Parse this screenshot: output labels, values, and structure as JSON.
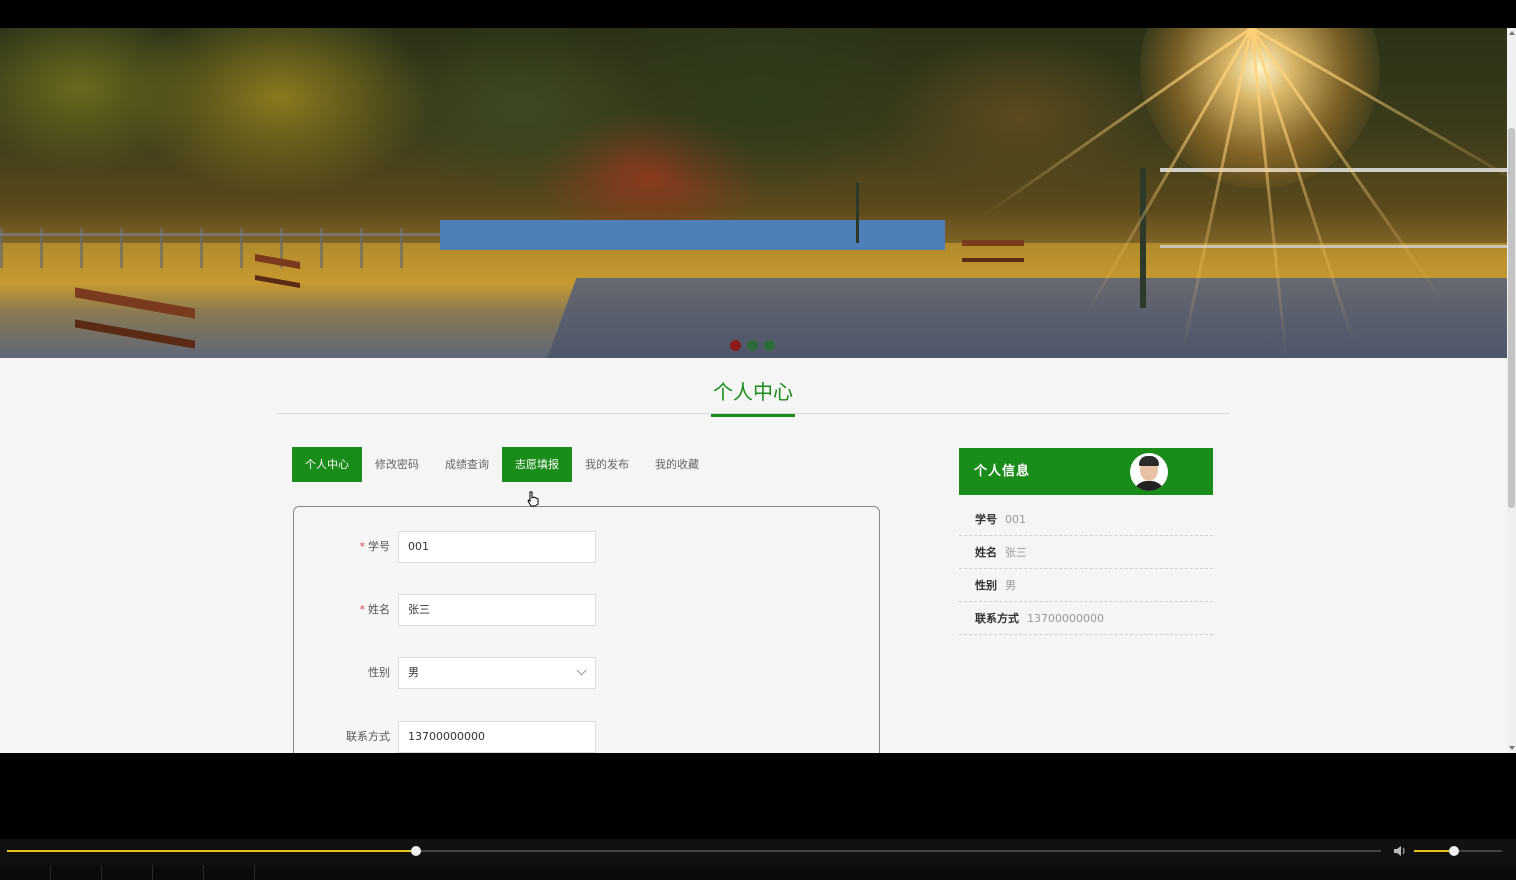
{
  "banner": {
    "carousel_dots": [
      {
        "active": true,
        "color": "#8b1a1a"
      },
      {
        "active": false,
        "color": "#2e6b3a"
      },
      {
        "active": false,
        "color": "#2e6b3a"
      }
    ]
  },
  "section_title": "个人中心",
  "tabs": [
    {
      "label": "个人中心",
      "state": "active"
    },
    {
      "label": "修改密码",
      "state": "normal"
    },
    {
      "label": "成绩查询",
      "state": "normal"
    },
    {
      "label": "志愿填报",
      "state": "hover"
    },
    {
      "label": "我的发布",
      "state": "normal"
    },
    {
      "label": "我的收藏",
      "state": "normal"
    }
  ],
  "form": {
    "student_id": {
      "label": "学号",
      "required": true,
      "value": "001"
    },
    "name": {
      "label": "姓名",
      "required": true,
      "value": "张三"
    },
    "gender": {
      "label": "性别",
      "required": false,
      "value": "男"
    },
    "phone": {
      "label": "联系方式",
      "required": false,
      "value": "13700000000"
    }
  },
  "info_panel": {
    "title": "个人信息",
    "rows": [
      {
        "key": "学号",
        "value": "001"
      },
      {
        "key": "姓名",
        "value": "张三"
      },
      {
        "key": "性别",
        "value": "男"
      },
      {
        "key": "联系方式",
        "value": "13700000000"
      }
    ]
  },
  "player": {
    "progress": 0.298,
    "volume": 0.45,
    "accent_color": "#e6c41c",
    "volume_icon": "speaker-icon"
  },
  "colors": {
    "primary_green": "#1a8c1a",
    "required_mark": "#e04848"
  }
}
